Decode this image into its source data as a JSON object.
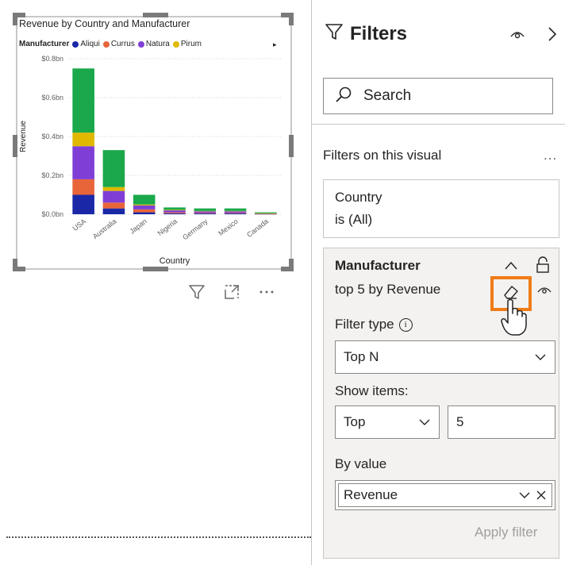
{
  "chart": {
    "title": "Revenue by Country and Manufacturer",
    "legend_title": "Manufacturer",
    "legend_arrow": "▸"
  },
  "chart_data": {
    "type": "bar",
    "stacked": true,
    "title": "Revenue by Country and Manufacturer",
    "xlabel": "Country",
    "ylabel": "Revenue",
    "ylim": [
      0,
      0.8
    ],
    "yticks": [
      0,
      0.2,
      0.4,
      0.6,
      0.8
    ],
    "ytick_labels": [
      "$0.0bn",
      "$0.2bn",
      "$0.4bn",
      "$0.6bn",
      "$0.8bn"
    ],
    "grid": true,
    "legend_position": "top-left",
    "categories": [
      "USA",
      "Australia",
      "Japan",
      "Nigeria",
      "Germany",
      "Mexico",
      "Canada"
    ],
    "series": [
      {
        "name": "Aliqui",
        "color": "#1a28a8",
        "values": [
          0.1,
          0.03,
          0.01,
          0.005,
          0.004,
          0.004,
          0.001
        ]
      },
      {
        "name": "Currus",
        "color": "#e8653a",
        "values": [
          0.08,
          0.03,
          0.015,
          0.005,
          0.003,
          0.003,
          0.001
        ]
      },
      {
        "name": "Natura",
        "color": "#7f3fd6",
        "values": [
          0.17,
          0.06,
          0.02,
          0.01,
          0.008,
          0.008,
          0.002
        ]
      },
      {
        "name": "Pirum",
        "color": "#e0b800",
        "values": [
          0.07,
          0.02,
          0.005,
          0.003,
          0.002,
          0.002,
          0.001
        ]
      },
      {
        "name": "",
        "color": "#1aa84a",
        "values": [
          0.33,
          0.19,
          0.05,
          0.012,
          0.013,
          0.013,
          0.005
        ]
      }
    ]
  },
  "filters_pane": {
    "title": "Filters",
    "search_placeholder": "Search",
    "section_label": "Filters on this visual",
    "section_more": "...",
    "country_card": {
      "name": "Country",
      "value": "is (All)"
    },
    "manufacturer_card": {
      "name": "Manufacturer",
      "summary": "top 5 by Revenue",
      "filter_type_label": "Filter type",
      "filter_type_value": "Top N",
      "show_items_label": "Show items:",
      "show_items_direction": "Top",
      "show_items_count": "5",
      "by_value_label": "By value",
      "by_value_field": "Revenue",
      "apply_label": "Apply filter"
    }
  }
}
